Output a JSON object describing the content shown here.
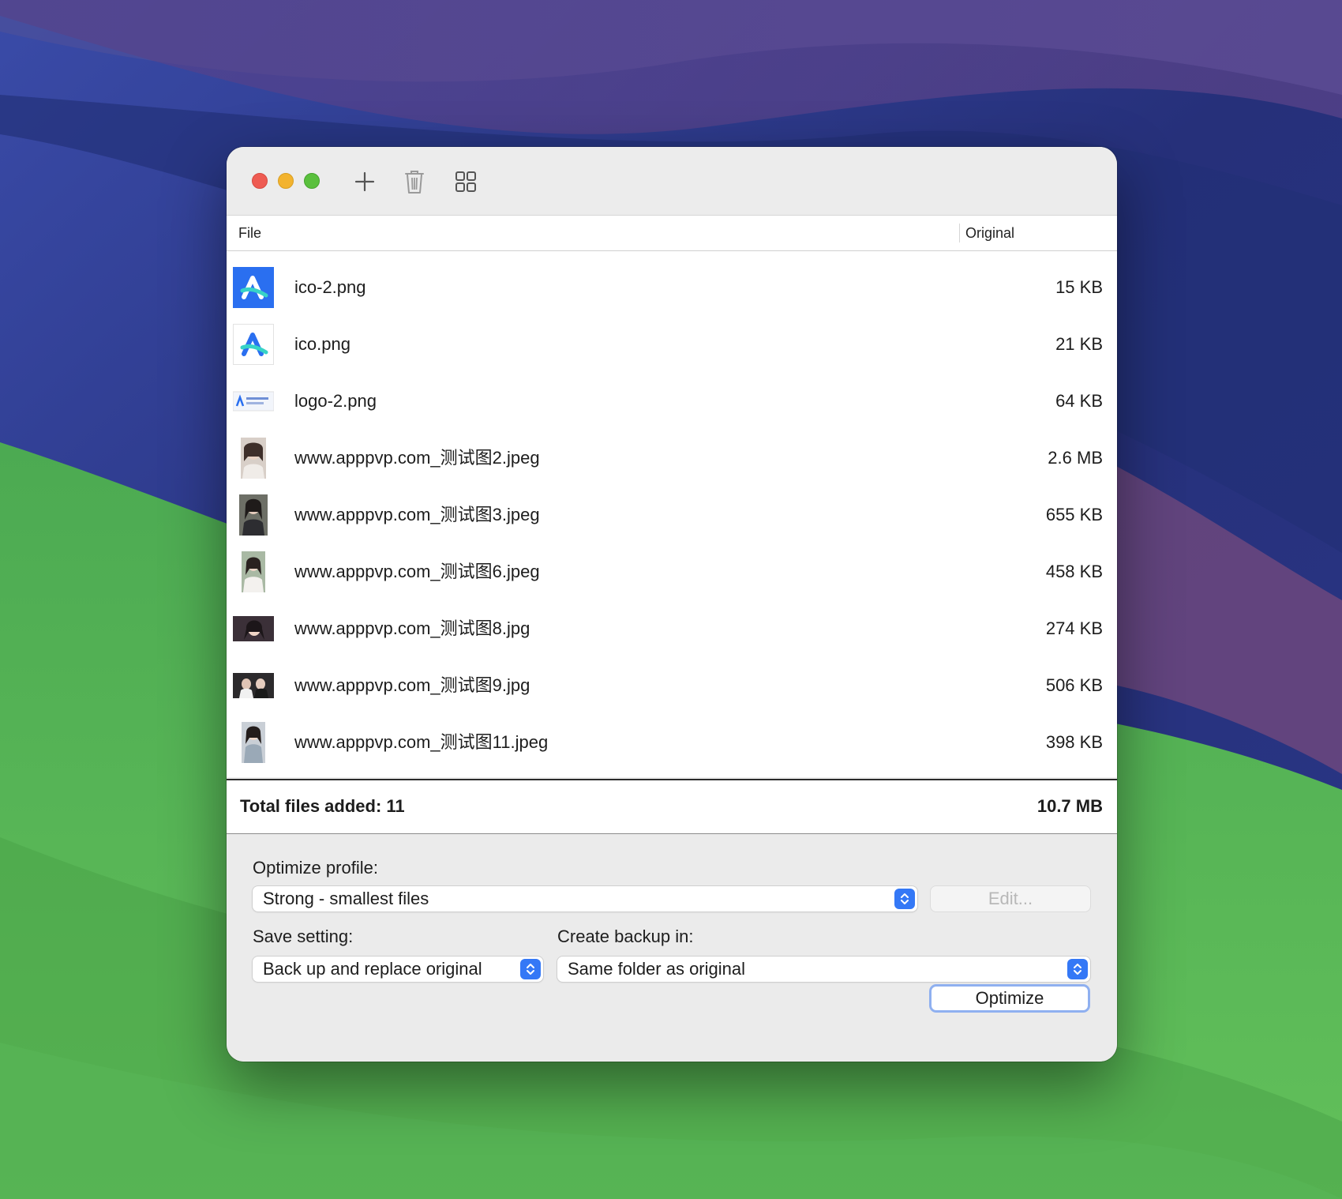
{
  "window": {
    "toolbar": {
      "add_icon": "plus-icon",
      "delete_icon": "trash-icon",
      "view_icon": "grid-icon"
    }
  },
  "table": {
    "columns": {
      "file": "File",
      "original": "Original"
    },
    "rows": [
      {
        "name": "ico-2.png",
        "size": "15 KB",
        "thumb": "app-logo-blue-bg"
      },
      {
        "name": "ico.png",
        "size": "21 KB",
        "thumb": "app-logo-white-bg"
      },
      {
        "name": "logo-2.png",
        "size": "64 KB",
        "thumb": "wide-logo"
      },
      {
        "name": "www.apppvp.com_测试图2.jpeg",
        "size": "2.6 MB",
        "thumb": "photo"
      },
      {
        "name": "www.apppvp.com_测试图3.jpeg",
        "size": "655 KB",
        "thumb": "photo"
      },
      {
        "name": "www.apppvp.com_测试图6.jpeg",
        "size": "458 KB",
        "thumb": "photo"
      },
      {
        "name": "www.apppvp.com_测试图8.jpg",
        "size": "274 KB",
        "thumb": "photo-wide"
      },
      {
        "name": "www.apppvp.com_测试图9.jpg",
        "size": "506 KB",
        "thumb": "photo-wide"
      },
      {
        "name": "www.apppvp.com_测试图11.jpeg",
        "size": "398 KB",
        "thumb": "photo"
      }
    ],
    "total_label": "Total files added: 11",
    "total_size": "10.7 MB"
  },
  "settings": {
    "profile_label": "Optimize profile:",
    "profile_value": "Strong - smallest files",
    "edit_button": "Edit...",
    "save_label": "Save setting:",
    "save_value": "Back up and replace original",
    "backup_label": "Create backup in:",
    "backup_value": "Same folder as original",
    "optimize_button": "Optimize"
  },
  "colors": {
    "accent": "#3478f6",
    "close": "#ee5b52",
    "minimize": "#f3b32e",
    "maximize": "#5ac03d"
  }
}
